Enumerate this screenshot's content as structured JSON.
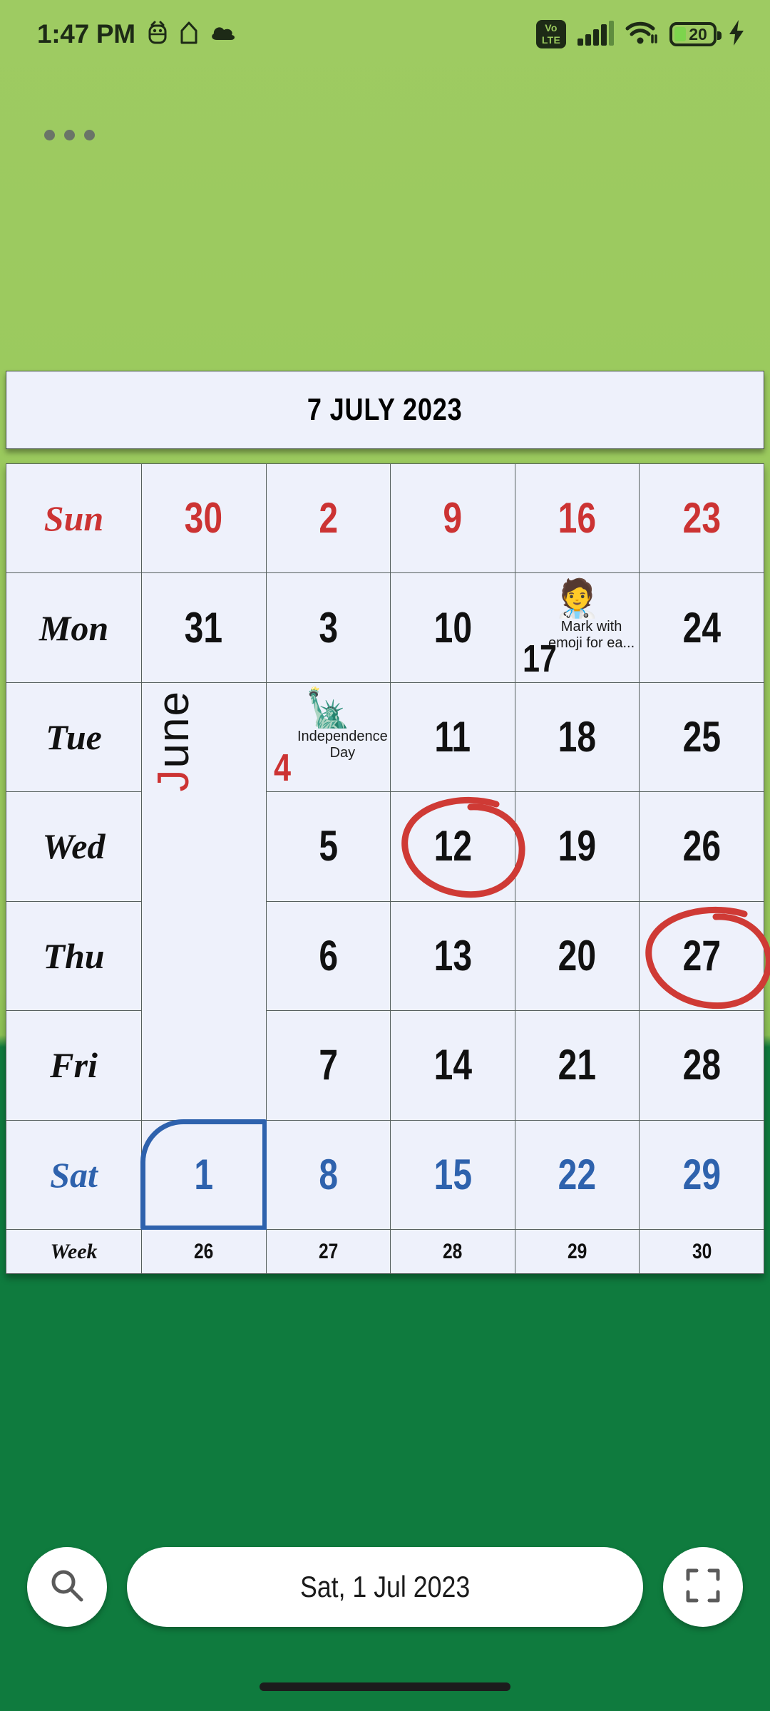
{
  "status_bar": {
    "time": "1:47 PM",
    "left_icons": [
      "android-debug-icon",
      "home-shortcut-icon",
      "cloud-icon"
    ],
    "volte_label_top": "Vo",
    "volte_label_bottom": "LTE",
    "signal_icon": "signal-bars-icon",
    "wifi_icon": "wifi-icon",
    "battery_level": "20",
    "charging_icon": "lightning-bolt-icon"
  },
  "overflow_menu": {
    "icon": "more-options-icon",
    "dots": 3
  },
  "header": {
    "title": "7 JULY 2023"
  },
  "calendar": {
    "day_labels": [
      "Sun",
      "Mon",
      "Tue",
      "Wed",
      "Thu",
      "Fri",
      "Sat"
    ],
    "week_label": "Week",
    "week_numbers": [
      "26",
      "27",
      "28",
      "29",
      "30"
    ],
    "vertical_month": "June",
    "rows": [
      {
        "day": "Sun",
        "color": "red",
        "cells": [
          {
            "num": "30"
          },
          {
            "num": "2"
          },
          {
            "num": "9"
          },
          {
            "num": "16"
          },
          {
            "num": "23"
          }
        ]
      },
      {
        "day": "Mon",
        "color": "black",
        "cells": [
          {
            "num": "31"
          },
          {
            "num": "3"
          },
          {
            "num": "10"
          },
          {
            "num": "17",
            "emoji": "health-worker-emoji",
            "emoji_char": "🧑‍⚕️",
            "event": "Mark with emoji  for ea..."
          },
          {
            "num": "24"
          }
        ]
      },
      {
        "day": "Tue",
        "color": "black",
        "cells": [
          {
            "num": "",
            "vertical_month": "June"
          },
          {
            "num": "4",
            "num_color": "red",
            "emoji": "statue-of-liberty-emoji",
            "emoji_char": "🗽",
            "event": "Independence Day"
          },
          {
            "num": "11"
          },
          {
            "num": "18"
          },
          {
            "num": "25"
          }
        ]
      },
      {
        "day": "Wed",
        "color": "black",
        "cells": [
          {
            "num": ""
          },
          {
            "num": "5"
          },
          {
            "num": "12",
            "circled": true
          },
          {
            "num": "19"
          },
          {
            "num": "26"
          }
        ]
      },
      {
        "day": "Thu",
        "color": "black",
        "cells": [
          {
            "num": ""
          },
          {
            "num": "6"
          },
          {
            "num": "13"
          },
          {
            "num": "20"
          },
          {
            "num": "27",
            "circled": true
          }
        ]
      },
      {
        "day": "Fri",
        "color": "black",
        "cells": [
          {
            "num": ""
          },
          {
            "num": "7"
          },
          {
            "num": "14"
          },
          {
            "num": "21"
          },
          {
            "num": "28"
          }
        ]
      },
      {
        "day": "Sat",
        "color": "blue",
        "cells": [
          {
            "num": "1",
            "selected": true
          },
          {
            "num": "8"
          },
          {
            "num": "15"
          },
          {
            "num": "22"
          },
          {
            "num": "29"
          }
        ]
      }
    ]
  },
  "bottom_bar": {
    "search_icon": "search-icon",
    "selected_date": "Sat, 1 Jul 2023",
    "fullscreen_icon": "fullscreen-icon"
  },
  "colors": {
    "bg_light_green": "#9ac95d",
    "bg_dark_green": "#0f7b3e",
    "cell_bg": "#eef1fb",
    "sunday_red": "#cc3333",
    "saturday_blue": "#2e62ad",
    "annotation_red": "#cf3a35"
  }
}
